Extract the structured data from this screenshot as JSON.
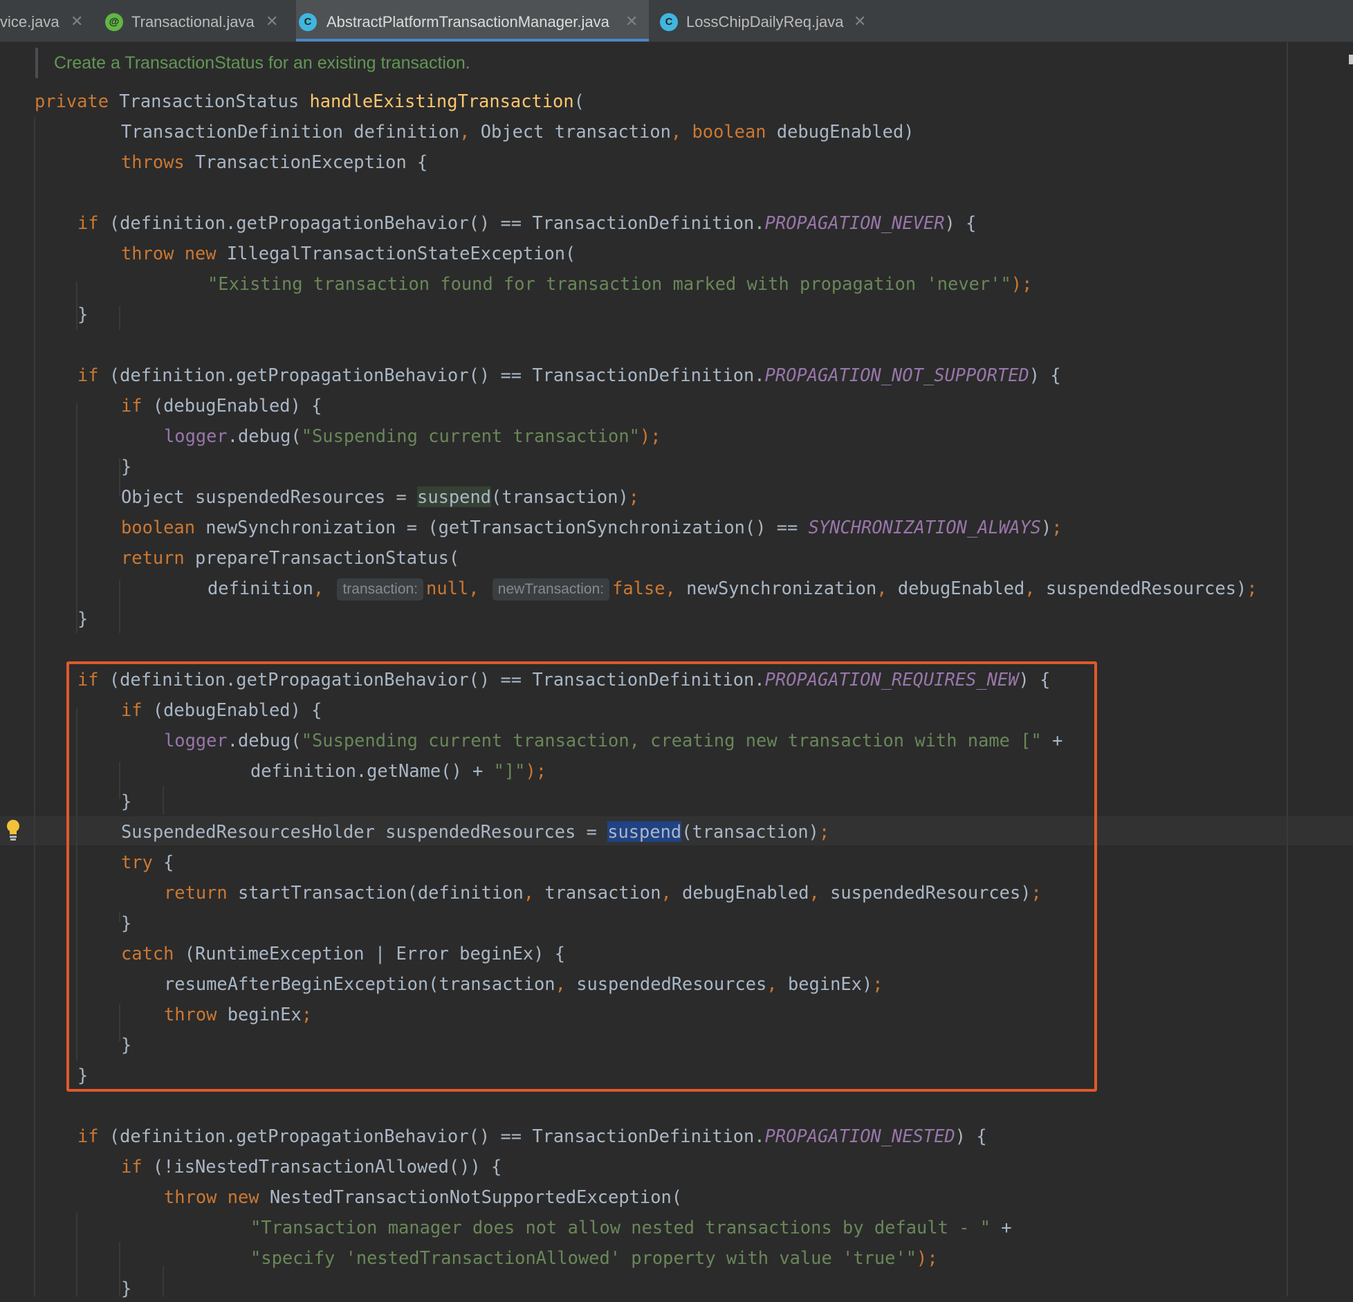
{
  "tabs": [
    {
      "label": "vice.java",
      "icon": "",
      "active": false
    },
    {
      "label": "Transactional.java",
      "icon": "@",
      "active": false
    },
    {
      "label": "AbstractPlatformTransactionManager.java",
      "icon": "C",
      "active": true
    },
    {
      "label": "LossChipDailyReq.java",
      "icon": "C",
      "active": false
    }
  ],
  "editor": {
    "doc_comment": "Create a TransactionStatus for an existing transaction.",
    "lines": {
      "l1": [
        "private",
        " TransactionStatus ",
        "handleExistingTransaction",
        "("
      ],
      "l2": [
        "TransactionDefinition definition",
        ",",
        " Object transaction",
        ",",
        " ",
        "boolean",
        " debugEnabled)"
      ],
      "l3": [
        "throws",
        " TransactionException {"
      ],
      "l4": [
        "if",
        " (definition.getPropagationBehavior() == TransactionDefinition.",
        "PROPAGATION_NEVER",
        ") {"
      ],
      "l5": [
        "throw",
        " ",
        "new",
        " IllegalTransactionStateException("
      ],
      "l6": [
        "\"Existing transaction found for transaction marked with propagation 'never'\"",
        ");"
      ],
      "l7": [
        "}"
      ],
      "l8": [
        "if",
        " (definition.getPropagationBehavior() == TransactionDefinition.",
        "PROPAGATION_NOT_SUPPORTED",
        ") {"
      ],
      "l9": [
        "if",
        " (debugEnabled) {"
      ],
      "l10": [
        "logger",
        ".debug(",
        "\"Suspending current transaction\"",
        ");"
      ],
      "l11": [
        "}"
      ],
      "l12": [
        "Object suspendedResources = ",
        "suspend",
        "(transaction)",
        ";"
      ],
      "l13": [
        "boolean",
        " newSynchronization = (getTransactionSynchronization() == ",
        "SYNCHRONIZATION_ALWAYS",
        ")",
        ";"
      ],
      "l14": [
        "return",
        " prepareTransactionStatus("
      ],
      "l15": [
        "definition",
        ",",
        "transaction:",
        "null",
        ",",
        "newTransaction:",
        "false",
        ",",
        " newSynchronization",
        ",",
        " debugEnabled",
        ",",
        " suspendedResources)",
        ";"
      ],
      "l16": [
        "}"
      ],
      "l17": [
        "if",
        " (definition.getPropagationBehavior() == TransactionDefinition.",
        "PROPAGATION_REQUIRES_NEW",
        ") {"
      ],
      "l18": [
        "if",
        " (debugEnabled) {"
      ],
      "l19": [
        "logger",
        ".debug(",
        "\"Suspending current transaction, creating new transaction with name [\"",
        " +"
      ],
      "l20": [
        "definition.getName() + ",
        "\"]\"",
        ");"
      ],
      "l21": [
        "}"
      ],
      "l22": [
        "SuspendedResourcesHolder suspendedResources = ",
        "suspend",
        "(transaction)",
        ";"
      ],
      "l23": [
        "try",
        " {"
      ],
      "l24": [
        "return",
        " startTransaction(definition",
        ",",
        " transaction",
        ",",
        " debugEnabled",
        ",",
        " suspendedResources)",
        ";"
      ],
      "l25": [
        "}"
      ],
      "l26": [
        "catch",
        " (RuntimeException | Error beginEx) {"
      ],
      "l27": [
        "resumeAfterBeginException(transaction",
        ",",
        " suspendedResources",
        ",",
        " beginEx)",
        ";"
      ],
      "l28": [
        "throw",
        " beginEx",
        ";"
      ],
      "l29": [
        "}"
      ],
      "l30": [
        "}"
      ],
      "l31": [
        "if",
        " (definition.getPropagationBehavior() == TransactionDefinition.",
        "PROPAGATION_NESTED",
        ") {"
      ],
      "l32": [
        "if",
        " (!isNestedTransactionAllowed()) {"
      ],
      "l33": [
        "throw",
        " ",
        "new",
        " NestedTransactionNotSupportedException("
      ],
      "l34": [
        "\"Transaction manager does not allow nested transactions by default - \"",
        " +"
      ],
      "l35": [
        "\"specify 'nestedTransactionAllowed' property with value 'true'\"",
        ");"
      ],
      "l36": [
        "}"
      ]
    }
  },
  "colors": {
    "keyword": "#cc7832",
    "method_decl": "#ffc66d",
    "constant": "#9876aa",
    "string": "#6a8759",
    "comment": "#629755",
    "text": "#a9b7c6",
    "highlight_box": "#e0592a"
  },
  "icons": {
    "close": "close-icon",
    "annotation": "annotation-file-icon",
    "class": "class-file-icon",
    "bulb": "lightbulb-icon"
  }
}
